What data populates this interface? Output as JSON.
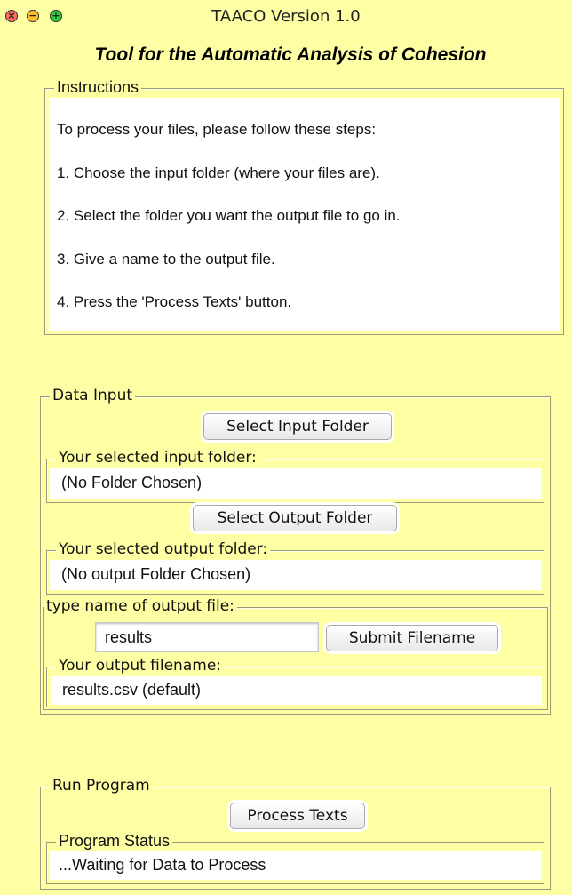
{
  "window": {
    "title": "TAACO Version 1.0",
    "heading": "Tool for the Automatic Analysis of Cohesion"
  },
  "instructions": {
    "legend": "Instructions",
    "lines": [
      "To process your files, please follow these steps:",
      "1. Choose the input folder (where your files are).",
      "2. Select the folder you want the output file to go in.",
      "3. Give a name to the output file.",
      "4. Press the 'Process Texts' button."
    ]
  },
  "data_input": {
    "legend": "Data Input",
    "select_input_button": "Select Input Folder",
    "input_folder_legend": "Your selected input folder:",
    "input_folder_value": "(No Folder Chosen)",
    "select_output_button": "Select Output Folder",
    "output_folder_legend": "Your selected output folder:",
    "output_folder_value": "(No output Folder Chosen)",
    "filename_legend": "type name of output file:",
    "filename_input_value": "results",
    "submit_filename_button": "Submit Filename",
    "output_filename_legend": "Your output filename:",
    "output_filename_value": "results.csv (default)"
  },
  "run_program": {
    "legend": "Run Program",
    "process_button": "Process Texts",
    "status_legend": "Program Status",
    "status_value": "...Waiting for Data to Process"
  },
  "colors": {
    "background": "#fefea5",
    "close": "#ff6a5e",
    "minimize": "#ffc02f",
    "zoom": "#2bd03f"
  }
}
